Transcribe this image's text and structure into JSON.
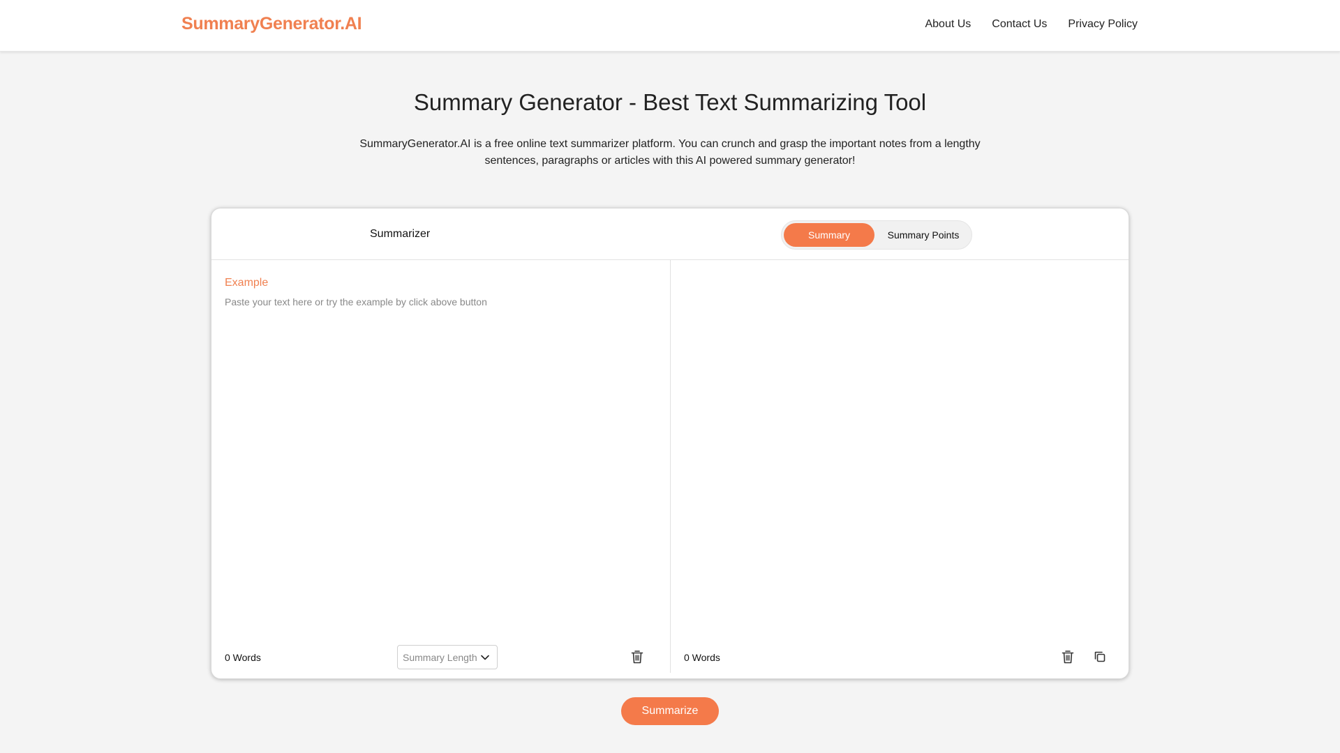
{
  "brand": {
    "name": "SummaryGenerator.AI",
    "accent": "#f47a4a"
  },
  "nav": {
    "about": "About Us",
    "contact": "Contact Us",
    "privacy": "Privacy Policy"
  },
  "hero": {
    "title": "Summary Generator - Best Text Summarizing Tool",
    "description": "SummaryGenerator.AI is a free online text summarizer platform. You can crunch and grasp the important notes from a lengthy sentences, paragraphs or articles with this AI powered summary generator!"
  },
  "card": {
    "title": "Summarizer",
    "tabs": [
      {
        "label": "Summary",
        "active": true
      },
      {
        "label": "Summary Points",
        "active": false
      }
    ],
    "input": {
      "example_label": "Example",
      "value": "",
      "placeholder": "Paste your text here or try the example by click above button",
      "word_count": "0 Words",
      "length_select": "Summary Length"
    },
    "output": {
      "word_count": "0 Words"
    }
  },
  "actions": {
    "summarize": "Summarize"
  },
  "icons": {
    "trash": "trash-icon",
    "copy": "copy-icon",
    "chevron": "chevron-down-icon"
  }
}
